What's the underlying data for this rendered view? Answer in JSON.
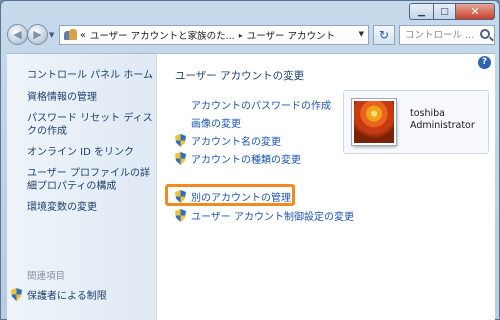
{
  "window": {
    "minimize_label": "▁",
    "maximize_label": "□",
    "close_label": "✕"
  },
  "navbar": {
    "back_icon": "back-arrow-icon",
    "forward_icon": "forward-arrow-icon",
    "address": {
      "overflow": "«",
      "segments": [
        "ユーザー アカウントと家族のた...",
        "ユーザー アカウント"
      ],
      "separator": "▸"
    },
    "search_placeholder": "コントロール ..."
  },
  "sidebar": {
    "home": "コントロール パネル ホーム",
    "links": [
      "資格情報の管理",
      "パスワード リセット ディスクの作成",
      "オンライン ID をリンク",
      "ユーザー プロファイルの詳細プロパティの構成",
      "環境変数の変更"
    ],
    "related_heading": "関連項目",
    "parental_controls": "保護者による制限"
  },
  "main": {
    "title": "ユーザー アカウントの変更",
    "tasks": [
      {
        "label": "アカウントのパスワードの作成",
        "shield": false
      },
      {
        "label": "画像の変更",
        "shield": false
      },
      {
        "label": "アカウント名の変更",
        "shield": true
      },
      {
        "label": "アカウントの種類の変更",
        "shield": true
      }
    ],
    "tasks2": [
      {
        "label": "別のアカウントの管理",
        "shield": true,
        "highlighted": true
      },
      {
        "label": "ユーザー アカウント制御設定の変更",
        "shield": true
      }
    ],
    "account": {
      "name": "toshiba",
      "type": "Administrator"
    },
    "help_label": "?"
  },
  "colors": {
    "link": "#1d55b3",
    "highlight_border": "#f08c1e",
    "sidebar_text": "#1e3f6e"
  }
}
